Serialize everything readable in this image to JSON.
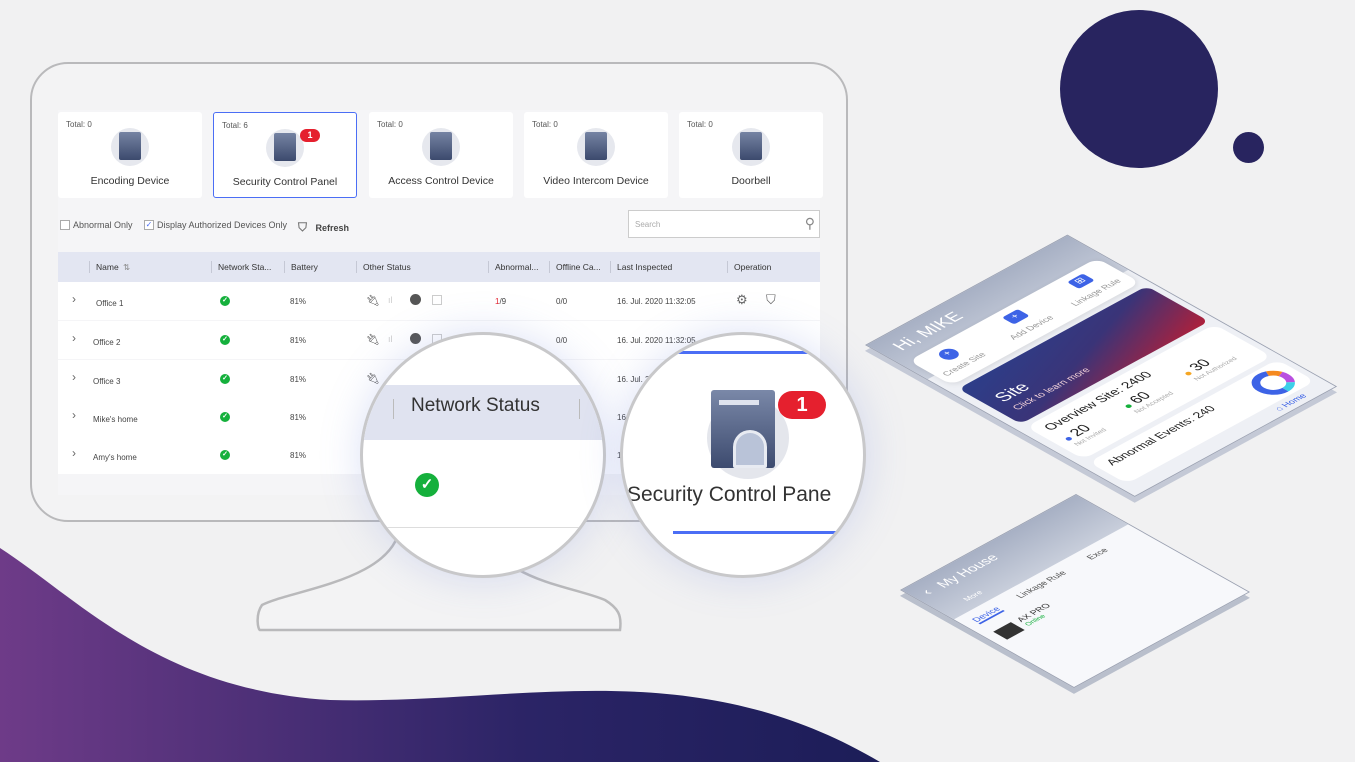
{
  "colors": {
    "accent": "#4b6ef5",
    "ok": "#15b03c",
    "badge": "#e5202e",
    "navy": "#28245f",
    "purple": "#6b3a86"
  },
  "device_cards": [
    {
      "total": "Total: 0",
      "label": "Encoding Device",
      "icon": "encoder-icon"
    },
    {
      "total": "Total: 6",
      "label": "Security Control Panel",
      "icon": "security-panel-icon",
      "badge": "1",
      "selected": true
    },
    {
      "total": "Total: 0",
      "label": "Access Control Device",
      "icon": "access-control-icon"
    },
    {
      "total": "Total: 0",
      "label": "Video Intercom Device",
      "icon": "video-intercom-icon"
    },
    {
      "total": "Total: 0",
      "label": "Doorbell",
      "icon": "doorbell-icon"
    }
  ],
  "filters": {
    "abnormal_only": "Abnormal Only",
    "abnormal_checked": false,
    "authorized_only": "Display Authorized Devices Only",
    "authorized_checked": true,
    "refresh": "Refresh"
  },
  "search": {
    "placeholder": "Search"
  },
  "table": {
    "columns": [
      "Name",
      "Network Sta...",
      "Battery",
      "Other Status",
      "Abnormal...",
      "Offline Ca...",
      "Last Inspected",
      "Operation"
    ],
    "rows": [
      {
        "name": "Office 1",
        "battery": "81%",
        "abn_a": "1",
        "abn_b": "/9",
        "offline": "0/0",
        "inspected": "16. Jul. 2020 11:32:05"
      },
      {
        "name": "Office 2",
        "battery": "81%",
        "abn_a": "",
        "abn_b": "",
        "offline": "0/0",
        "inspected": "16. Jul. 2020 11:32:05"
      },
      {
        "name": "Office 3",
        "battery": "81%",
        "abn_a": "",
        "abn_b": "",
        "offline": "",
        "inspected": "16. Jul. 2"
      },
      {
        "name": "Mike's home",
        "battery": "81%",
        "abn_a": "",
        "abn_b": "",
        "offline": "",
        "inspected": "16"
      },
      {
        "name": "Amy's home",
        "battery": "81%",
        "abn_a": "",
        "abn_b": "",
        "offline": "",
        "inspected": "1"
      }
    ]
  },
  "magnifier": {
    "network_status": "Network Status",
    "security_label": "Security Control Pane",
    "badge": "1"
  },
  "phone": {
    "greeting": "Hi, MIKE",
    "actions": [
      "Create Site",
      "Add Device",
      "Linkage Rule"
    ],
    "banner_title": "Site",
    "banner_sub": "Click to learn more",
    "overview": "Overview Site:  2400",
    "stats": [
      {
        "value": "20",
        "label": "Not Invited",
        "color": "#3d63e6"
      },
      {
        "value": "60",
        "label": "Not Accepted",
        "color": "#15b03c"
      },
      {
        "value": "30",
        "label": "Not Authorized",
        "color": "#f5a623"
      }
    ],
    "abnormal": "Abnormal Events:  240",
    "nav_home": "Home"
  },
  "phone2": {
    "title": "My House",
    "more": "More",
    "tabs": [
      "Device",
      "Linkage Rule",
      "Exce"
    ],
    "device_name": "AX PRO",
    "device_status": "Online"
  }
}
